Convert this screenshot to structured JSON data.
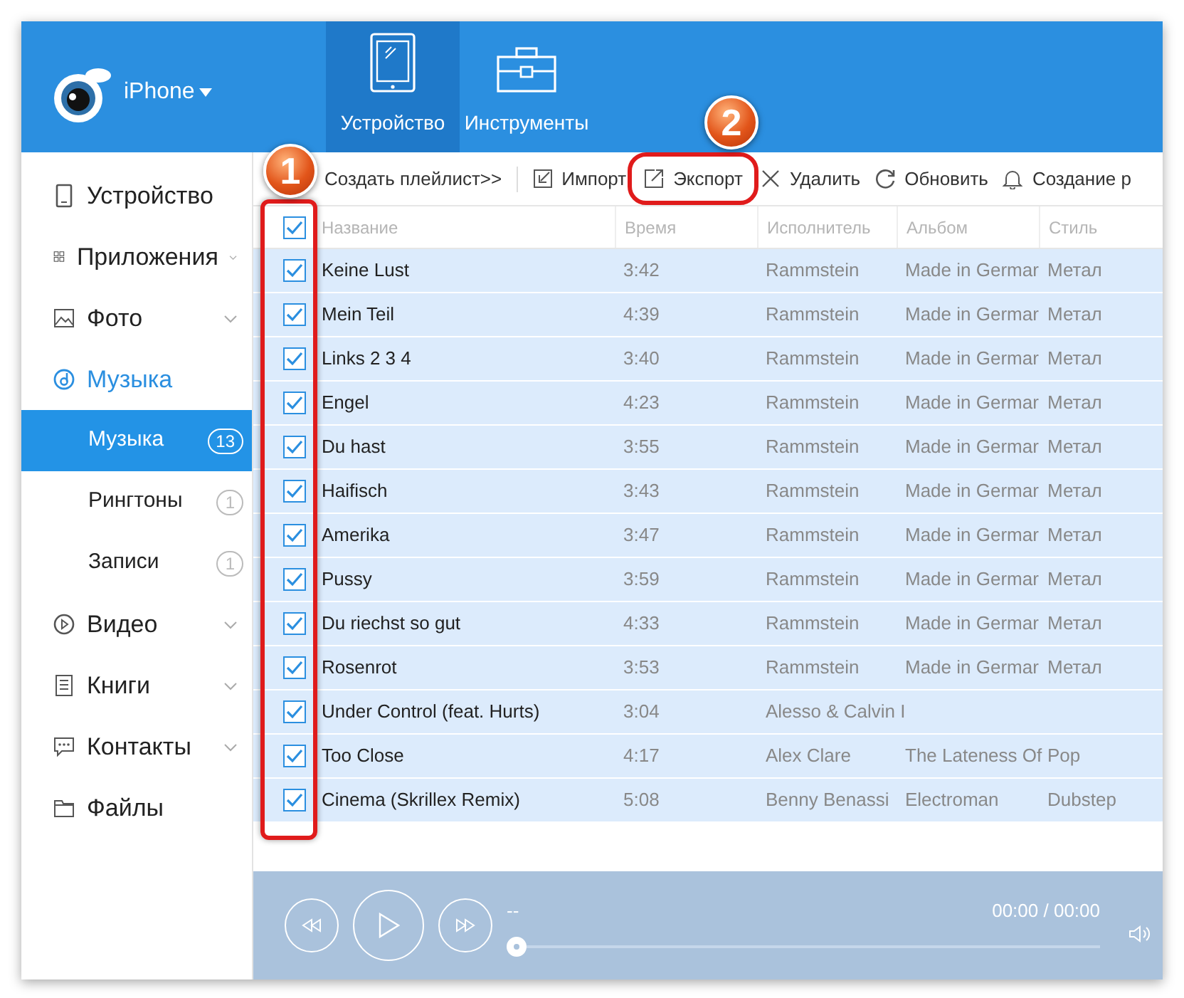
{
  "header": {
    "device": "iPhone",
    "tabs": [
      {
        "label": "Устройство",
        "selected": true
      },
      {
        "label": "Инструменты",
        "selected": false
      }
    ]
  },
  "sidebar": {
    "items": [
      {
        "label": "Устройство",
        "expandable": false,
        "expanded": false,
        "selected": false
      },
      {
        "label": "Приложения",
        "expandable": true,
        "expanded": false,
        "selected": false
      },
      {
        "label": "Фото",
        "expandable": true,
        "expanded": false,
        "selected": false
      },
      {
        "label": "Музыка",
        "expandable": false,
        "expanded": true,
        "selected": false,
        "children": [
          {
            "label": "Музыка",
            "count": "13",
            "selected": true
          },
          {
            "label": "Рингтоны",
            "count": "1",
            "selected": false
          },
          {
            "label": "Записи",
            "count": "1",
            "selected": false
          }
        ]
      },
      {
        "label": "Видео",
        "expandable": true,
        "expanded": false,
        "selected": false
      },
      {
        "label": "Книги",
        "expandable": true,
        "expanded": false,
        "selected": false
      },
      {
        "label": "Контакты",
        "expandable": true,
        "expanded": false,
        "selected": false
      },
      {
        "label": "Файлы",
        "expandable": false,
        "expanded": false,
        "selected": false
      }
    ]
  },
  "toolbar": [
    {
      "label": "Создать плейлист>>"
    },
    {
      "label": "Импорт"
    },
    {
      "label": "Экспорт"
    },
    {
      "label": "Удалить"
    },
    {
      "label": "Обновить"
    },
    {
      "label": "Создание р"
    }
  ],
  "table": {
    "all_checked": true,
    "columns": [
      "Название",
      "Время",
      "Исполнитель",
      "Альбом",
      "Стиль"
    ],
    "rows": [
      {
        "checked": true,
        "cells": [
          "Keine Lust",
          "3:42",
          "Rammstein",
          "Made in Germar",
          "Метал"
        ]
      },
      {
        "checked": true,
        "cells": [
          "Mein Teil",
          "4:39",
          "Rammstein",
          "Made in Germar",
          "Метал"
        ]
      },
      {
        "checked": true,
        "cells": [
          "Links 2 3 4",
          "3:40",
          "Rammstein",
          "Made in Germar",
          "Метал"
        ]
      },
      {
        "checked": true,
        "cells": [
          "Engel",
          "4:23",
          "Rammstein",
          "Made in Germar",
          "Метал"
        ]
      },
      {
        "checked": true,
        "cells": [
          "Du hast",
          "3:55",
          "Rammstein",
          "Made in Germar",
          "Метал"
        ]
      },
      {
        "checked": true,
        "cells": [
          "Haifisch",
          "3:43",
          "Rammstein",
          "Made in Germar",
          "Метал"
        ]
      },
      {
        "checked": true,
        "cells": [
          "Amerika",
          "3:47",
          "Rammstein",
          "Made in Germar",
          "Метал"
        ]
      },
      {
        "checked": true,
        "cells": [
          "Pussy",
          "3:59",
          "Rammstein",
          "Made in Germar",
          "Метал"
        ]
      },
      {
        "checked": true,
        "cells": [
          "Du riechst so gut",
          "4:33",
          "Rammstein",
          "Made in Germar",
          "Метал"
        ]
      },
      {
        "checked": true,
        "cells": [
          "Rosenrot",
          "3:53",
          "Rammstein",
          "Made in Germar",
          "Метал"
        ]
      },
      {
        "checked": true,
        "cells": [
          "Under Control (feat. Hurts)",
          "3:04",
          "Alesso & Calvin I"
        ]
      },
      {
        "checked": true,
        "cells": [
          "Too Close",
          "4:17",
          "Alex Clare",
          "The Lateness Of",
          "Pop"
        ]
      },
      {
        "checked": true,
        "cells": [
          "Cinema (Skrillex Remix)",
          "5:08",
          "Benny Benassi",
          "Electroman",
          "Dubstep"
        ]
      }
    ]
  },
  "player": {
    "track": "--",
    "time": "00:00 / 00:00",
    "level": 0
  },
  "annotations": [
    {
      "number": "1"
    },
    {
      "number": "2"
    }
  ]
}
